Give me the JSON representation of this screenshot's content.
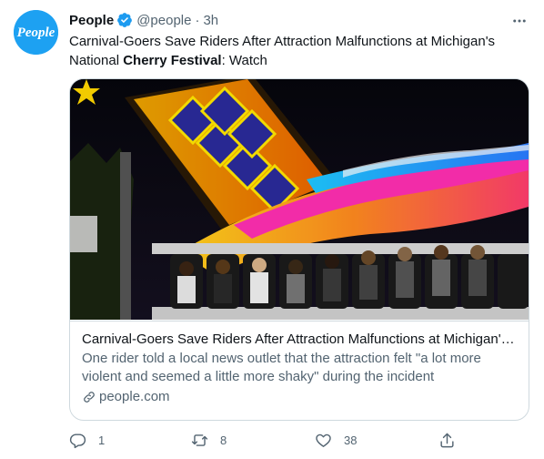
{
  "author": {
    "avatar_text": "People",
    "display_name": "People",
    "handle": "@people",
    "separator": "·",
    "time": "3h",
    "verified": true
  },
  "tweet": {
    "text_before": "Carnival-Goers Save Riders After Attraction Malfunctions at Michigan's National ",
    "text_bold": "Cherry Festival",
    "text_after": ": Watch"
  },
  "card": {
    "title": "Carnival-Goers Save Riders After Attraction Malfunctions at Michigan's ...",
    "description": "One rider told a local news outlet that the attraction felt \"a lot more violent and seemed a little more shaky\" during the incident",
    "domain": "people.com"
  },
  "actions": {
    "reply_count": "1",
    "retweet_count": "8",
    "like_count": "38"
  },
  "colors": {
    "brand": "#1da1f2",
    "secondary_text": "#536471",
    "border": "#cfd9de"
  },
  "icons": {
    "more": "more-horizontal-icon",
    "verified": "verified-badge-icon",
    "link": "link-icon",
    "reply": "reply-icon",
    "retweet": "retweet-icon",
    "like": "heart-icon",
    "share": "share-icon"
  }
}
